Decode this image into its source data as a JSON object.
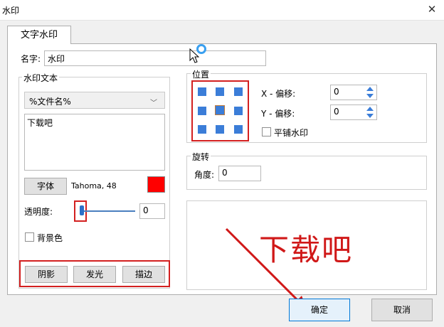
{
  "window": {
    "title": "水印",
    "close_glyph": "✕"
  },
  "tab": {
    "label": "文字水印"
  },
  "name_field": {
    "label": "名字:",
    "value": "水印"
  },
  "watermark_text": {
    "group_title": "水印文本",
    "template_value": "%文件名%",
    "text_value": "下载吧",
    "font_button": "字体",
    "font_desc": "Tahoma, 48",
    "font_color": "#ff0000",
    "opacity_label": "透明度:",
    "opacity_value": "0",
    "background_label": "背景色",
    "shadow_button": "阴影",
    "glow_button": "发光",
    "stroke_button": "描边"
  },
  "position": {
    "group_title": "位置",
    "x_offset_label": "X - 偏移:",
    "x_offset_value": "0",
    "y_offset_label": "Y - 偏移:",
    "y_offset_value": "0",
    "tile_label": "平铺水印"
  },
  "rotation": {
    "group_title": "旋转",
    "angle_label": "角度:",
    "angle_value": "0"
  },
  "preview": {
    "text": "下载吧"
  },
  "buttons": {
    "ok": "确定",
    "cancel": "取消"
  },
  "colors": {
    "highlight": "#d32020",
    "accent": "#3b7dd8"
  },
  "watermark_logo": {
    "text": "下载吧"
  }
}
